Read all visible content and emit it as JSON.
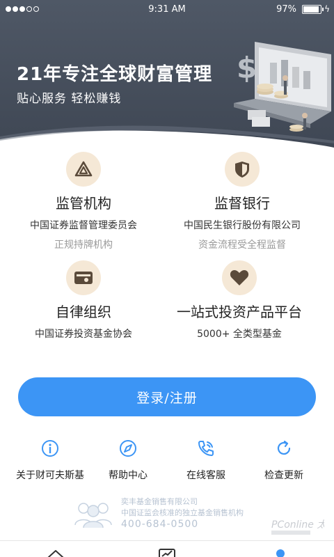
{
  "status_bar": {
    "time": "9:31 AM",
    "battery_percent": "97%",
    "signal_bars_filled": 3,
    "signal_bars_total": 5
  },
  "banner": {
    "title": "21年专注全球财富管理",
    "subtitle": "贴心服务 轻松赚钱"
  },
  "features": [
    {
      "icon": "regulator-icon",
      "title": "监管机构",
      "line1": "中国证券监督管理委员会",
      "line2": "正规持牌机构"
    },
    {
      "icon": "shield-icon",
      "title": "监督银行",
      "line1": "中国民生银行股份有限公司",
      "line2": "资金流程受全程监督"
    },
    {
      "icon": "card-icon",
      "title": "自律组织",
      "line1": "中国证券投资基金协会",
      "line2": ""
    },
    {
      "icon": "heart-icon",
      "title": "一站式投资产品平台",
      "line1": "5000+ 全类型基金",
      "line2": ""
    }
  ],
  "login_button": {
    "label": "登录/注册"
  },
  "quick_links": [
    {
      "icon": "info-icon",
      "label": "关于财可夫斯基"
    },
    {
      "icon": "compass-icon",
      "label": "帮助中心"
    },
    {
      "icon": "phone-icon",
      "label": "在线客服"
    },
    {
      "icon": "refresh-icon",
      "label": "检查更新"
    }
  ],
  "footer": {
    "company": "奕丰基金销售有限公司",
    "description": "中国证监会核准的独立基金销售机构",
    "phone": "400-684-0500"
  },
  "watermark": "PConline 太平洋电脑网",
  "tabbar": {
    "icons": [
      "home-icon",
      "chart-icon",
      "profile-icon"
    ]
  },
  "colors": {
    "banner": "#4a525f",
    "accent": "#3c95f5",
    "icon_bg": "#f5e8d6",
    "icon_fg": "#5a4a3a",
    "quick_icon": "#3c95f5",
    "footer_text": "#b7c3d2"
  }
}
